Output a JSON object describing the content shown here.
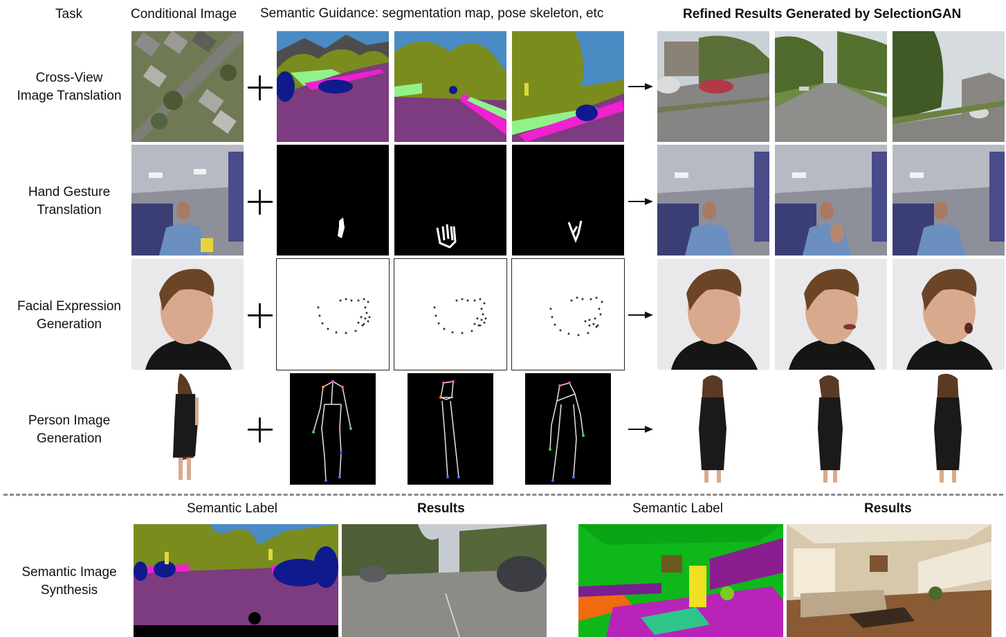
{
  "headers": {
    "task": "Task",
    "conditional": "Conditional Image",
    "guidance": "Semantic Guidance: segmentation map, pose skeleton, etc",
    "results": "Refined Results Generated by SelectionGAN"
  },
  "rows": [
    {
      "line1": "Cross-View",
      "line2": "Image Translation"
    },
    {
      "line1": "Hand Gesture",
      "line2": "Translation"
    },
    {
      "line1": "Facial Expression",
      "line2": "Generation"
    },
    {
      "line1": "Person Image",
      "line2": "Generation"
    }
  ],
  "bottom": {
    "task_line1": "Semantic Image",
    "task_line2": "Synthesis",
    "label_left": "Semantic Label",
    "results_left": "Results",
    "label_right": "Semantic Label",
    "results_right": "Results"
  }
}
